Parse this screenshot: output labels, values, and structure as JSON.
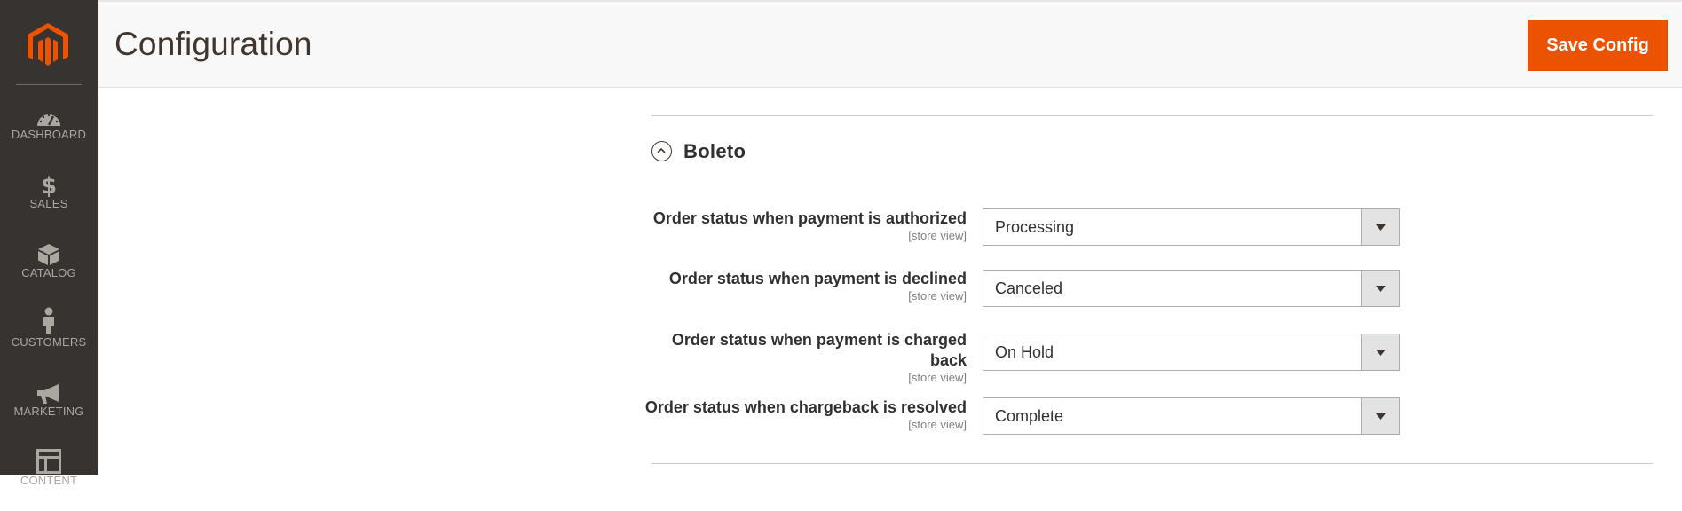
{
  "sidebar": {
    "logo": "magento-logo",
    "items": [
      {
        "label": "DASHBOARD",
        "icon": "dashboard-icon"
      },
      {
        "label": "SALES",
        "icon": "dollar-icon"
      },
      {
        "label": "CATALOG",
        "icon": "box-icon"
      },
      {
        "label": "CUSTOMERS",
        "icon": "person-icon"
      },
      {
        "label": "MARKETING",
        "icon": "megaphone-icon"
      },
      {
        "label": "CONTENT",
        "icon": "layout-icon"
      }
    ]
  },
  "header": {
    "title": "Configuration",
    "save_label": "Save Config"
  },
  "section": {
    "title": "Boleto",
    "rows": [
      {
        "label": "Order status when payment is authorized",
        "scope": "[store view]",
        "value": "Processing"
      },
      {
        "label": "Order status when payment is declined",
        "scope": "[store view]",
        "value": "Canceled"
      },
      {
        "label_line1": "Order status when payment is charged",
        "label_line2": "back",
        "scope": "[store view]",
        "value": "On Hold"
      },
      {
        "label": "Order status when chargeback is resolved",
        "scope": "[store view]",
        "value": "Complete"
      }
    ]
  },
  "colors": {
    "sidebar_bg": "#373330",
    "accent": "#eb5202"
  }
}
